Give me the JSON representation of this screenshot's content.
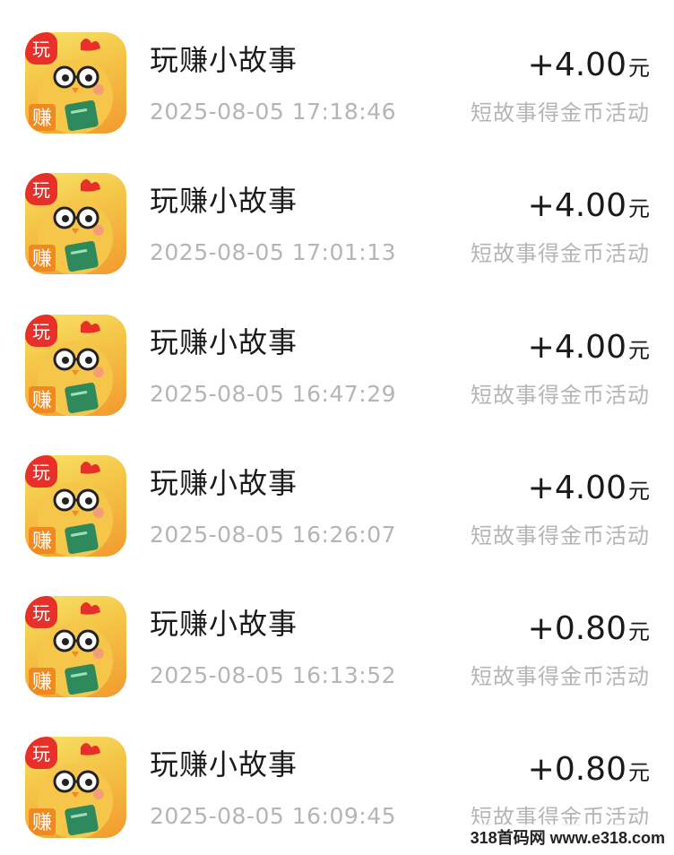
{
  "records": [
    {
      "app": "玩赚小故事",
      "time": "2025-08-05 17:18:46",
      "amount": "+4.00",
      "unit": "元",
      "desc": "短故事得金币活动"
    },
    {
      "app": "玩赚小故事",
      "time": "2025-08-05 17:01:13",
      "amount": "+4.00",
      "unit": "元",
      "desc": "短故事得金币活动"
    },
    {
      "app": "玩赚小故事",
      "time": "2025-08-05 16:47:29",
      "amount": "+4.00",
      "unit": "元",
      "desc": "短故事得金币活动"
    },
    {
      "app": "玩赚小故事",
      "time": "2025-08-05 16:26:07",
      "amount": "+4.00",
      "unit": "元",
      "desc": "短故事得金币活动"
    },
    {
      "app": "玩赚小故事",
      "time": "2025-08-05 16:13:52",
      "amount": "+0.80",
      "unit": "元",
      "desc": "短故事得金币活动"
    },
    {
      "app": "玩赚小故事",
      "time": "2025-08-05 16:09:45",
      "amount": "+0.80",
      "unit": "元",
      "desc": "短故事得金币活动"
    }
  ],
  "icon": {
    "name": "chick-with-glasses-app-icon",
    "badge_top": "玩",
    "badge_bottom": "赚"
  },
  "watermark": "318首码网 www.e318.com",
  "colors": {
    "title": "#1a1a1a",
    "secondary": "#b5b5b5",
    "icon_gradient_top": "#f7e36a",
    "icon_gradient_bottom": "#f29a2e",
    "badge_red": "#e8302a"
  }
}
